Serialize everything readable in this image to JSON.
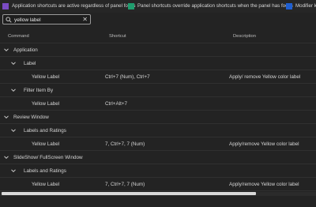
{
  "legend": [
    {
      "label": "Application shortcuts are active regardless of panel focus",
      "color": "#7a4bc4"
    },
    {
      "label": "Panel shortcuts override application shortcuts when the panel has focus",
      "color": "#1f9d6e"
    },
    {
      "label": "Modifier ke",
      "color": "#1f5fd1"
    }
  ],
  "search": {
    "value": "yellow label",
    "clear_glyph": "✕"
  },
  "columns": {
    "command": "Command",
    "shortcut": "Shortcut",
    "description": "Description"
  },
  "rows": [
    {
      "command": "Application",
      "shortcut": "",
      "description": ""
    },
    {
      "command": "Label",
      "shortcut": "",
      "description": ""
    },
    {
      "command": "Yellow Label",
      "shortcut": "Ctrl+7 (Num), Ctrl+7",
      "description": "Apply/ remove Yellow color label"
    },
    {
      "command": "Filter Item By",
      "shortcut": "",
      "description": ""
    },
    {
      "command": "Yellow Label",
      "shortcut": "Ctrl+Alt+7",
      "description": ""
    },
    {
      "command": "Review Window",
      "shortcut": "",
      "description": ""
    },
    {
      "command": "Labels and Ratings",
      "shortcut": "",
      "description": ""
    },
    {
      "command": "Yellow Label",
      "shortcut": "7, Ctrl+7, 7 (Num)",
      "description": "Apply/remove Yellow color label"
    },
    {
      "command": "SlideShow/ FullScreen Window",
      "shortcut": "",
      "description": ""
    },
    {
      "command": "Labels and Ratings",
      "shortcut": "",
      "description": ""
    },
    {
      "command": "Yellow Label",
      "shortcut": "7, Ctrl+7, 7 (Num)",
      "description": "Apply/remove Yellow color label"
    }
  ]
}
